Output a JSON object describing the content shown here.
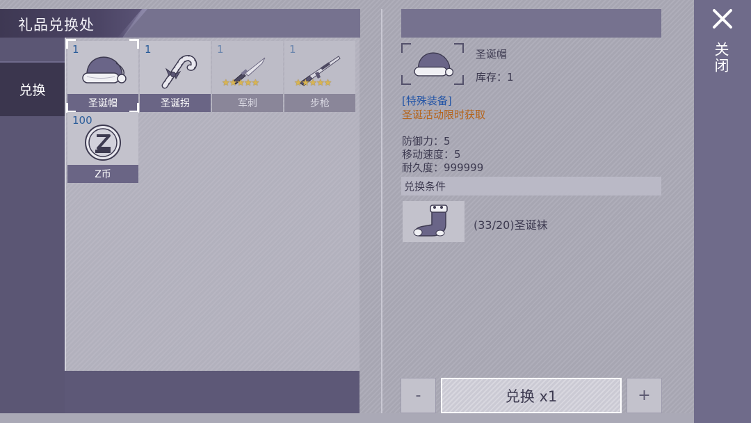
{
  "header": {
    "title": "礼品兑换处"
  },
  "nav": {
    "tabs": [
      {
        "label": "兑换"
      }
    ]
  },
  "items": [
    {
      "name": "圣诞帽",
      "count": "1",
      "icon": "santa-hat-icon",
      "selected": true
    },
    {
      "name": "圣诞拐",
      "count": "1",
      "icon": "candy-cane-icon",
      "selected": false
    },
    {
      "name": "军刺",
      "count": "1",
      "icon": "bayonet-icon",
      "stars": "★★★★★",
      "dim": true
    },
    {
      "name": "步枪",
      "count": "1",
      "icon": "rifle-icon",
      "stars": "★★★★★",
      "dim": true
    },
    {
      "name": "Z币",
      "count": "100",
      "icon": "z-coin-icon"
    }
  ],
  "detail": {
    "name": "圣诞帽",
    "stock_label": "库存：",
    "stock_value": "1",
    "tag": "[特殊装备]",
    "description": "圣诞活动限时获取",
    "stats": [
      {
        "text": "防御力：5"
      },
      {
        "text": "移动速度：5"
      },
      {
        "text": "耐久度：999999"
      }
    ],
    "condition_header": "兑换条件",
    "condition_text": "(33/20)圣诞袜",
    "condition_icon": "christmas-stocking-icon"
  },
  "controls": {
    "minus": "-",
    "plus": "+",
    "exchange": "兑换 x1"
  },
  "close": {
    "label": "关闭"
  },
  "colors": {
    "accent": "#3b364e",
    "tag_blue": "#2455a6",
    "desc_orange": "#b5641a",
    "count_blue": "#2b5d9a",
    "star_gold": "#d9b552"
  }
}
